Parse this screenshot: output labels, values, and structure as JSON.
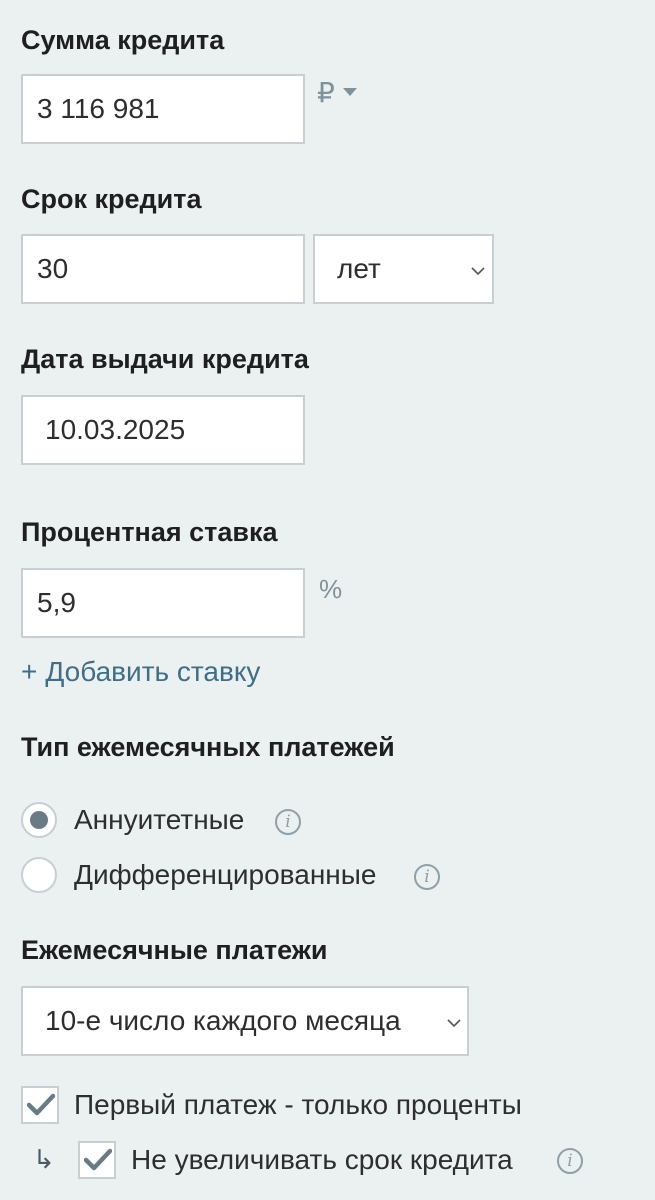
{
  "loan_amount": {
    "label": "Сумма кредита",
    "value": "3 116 981",
    "currency": "₽"
  },
  "loan_term": {
    "label": "Срок кредита",
    "value": "30",
    "unit_selected": "лет"
  },
  "issue_date": {
    "label": "Дата выдачи кредита",
    "value": "10.03.2025"
  },
  "interest_rate": {
    "label": "Процентная ставка",
    "value": "5,9",
    "unit": "%",
    "add_rate_plus": "+",
    "add_rate_label": "Добавить ставку"
  },
  "payment_type": {
    "label": "Тип ежемесячных платежей",
    "options": [
      {
        "label": "Аннуитетные",
        "selected": true
      },
      {
        "label": "Дифференцированные",
        "selected": false
      }
    ],
    "info_glyph": "i"
  },
  "monthly_payments": {
    "label": "Ежемесячные платежи",
    "selected": "10-е число каждого месяца"
  },
  "checkboxes": {
    "first_payment_interest_only": {
      "label": "Первый платеж - только проценты",
      "checked": true
    },
    "do_not_extend_term": {
      "label": "Не увеличивать срок кредита",
      "checked": true
    },
    "sub_arrow": "↳"
  },
  "colors": {
    "background": "#ebf0f1",
    "border": "#c7cfd3",
    "link": "#3f6e86",
    "muted": "#7f929c",
    "check": "#6a7b86"
  },
  "icons": [
    "ruble-icon",
    "chevron-down-icon",
    "info-icon",
    "checkmark-icon",
    "plus-icon",
    "sub-arrow-icon"
  ]
}
